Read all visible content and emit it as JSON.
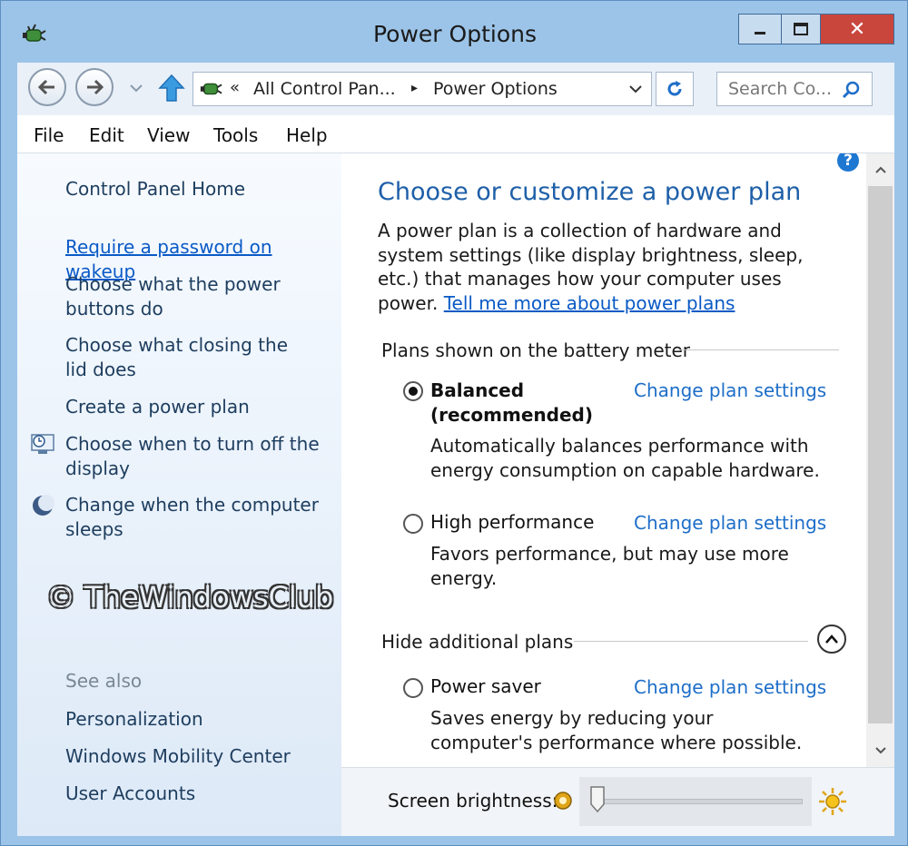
{
  "window": {
    "title": "Power Options",
    "close_label": "✕"
  },
  "address_bar": {
    "overflow_chevron": "«",
    "breadcrumb_parent": "All Control Pan...",
    "breadcrumb_separator": "▸",
    "breadcrumb_current": "Power Options"
  },
  "search": {
    "placeholder": "Search Co..."
  },
  "menu": [
    "File",
    "Edit",
    "View",
    "Tools",
    "Help"
  ],
  "sidebar": {
    "home": "Control Panel Home",
    "links": [
      "Require a password on wakeup",
      "Choose what the power buttons do",
      "Choose what closing the lid does",
      "Create a power plan",
      "Choose when to turn off the display",
      "Change when the computer sleeps"
    ],
    "watermark": "© TheWindowsClub",
    "see_also_title": "See also",
    "see_also": [
      "Personalization",
      "Windows Mobility Center",
      "User Accounts"
    ]
  },
  "main": {
    "help_glyph": "?",
    "heading": "Choose or customize a power plan",
    "intro_text": "A power plan is a collection of hardware and system settings (like display brightness, sleep, etc.) that manages how your computer uses power.",
    "intro_link": "Tell me more about power plans",
    "section_battery": "Plans shown on the battery meter",
    "section_hide": "Hide additional plans",
    "change_link": "Change plan settings",
    "plans": [
      {
        "name": "Balanced (recommended)",
        "description": "Automatically balances performance with energy consumption on capable hardware.",
        "selected": true
      },
      {
        "name": "High performance",
        "description": "Favors performance, but may use more energy.",
        "selected": false
      },
      {
        "name": "Power saver",
        "description": "Saves energy by reducing your computer's performance where possible.",
        "selected": false
      }
    ]
  },
  "brightness": {
    "label": "Screen brightness:",
    "level_percent": 0
  },
  "colors": {
    "accent_link": "#0a5ac6",
    "heading": "#1e5fa8",
    "close_button": "#c9463d",
    "window_frame": "#9cc4e8"
  },
  "icons": [
    "app-power-icon",
    "back-arrow-icon",
    "forward-arrow-icon",
    "recent-pages-chevron-icon",
    "up-arrow-icon",
    "dropdown-chevron-icon",
    "refresh-icon",
    "search-icon",
    "help-icon",
    "clock-monitor-icon",
    "moon-icon",
    "collapse-chevron-icon",
    "dim-brightness-icon",
    "bright-sun-icon"
  ]
}
